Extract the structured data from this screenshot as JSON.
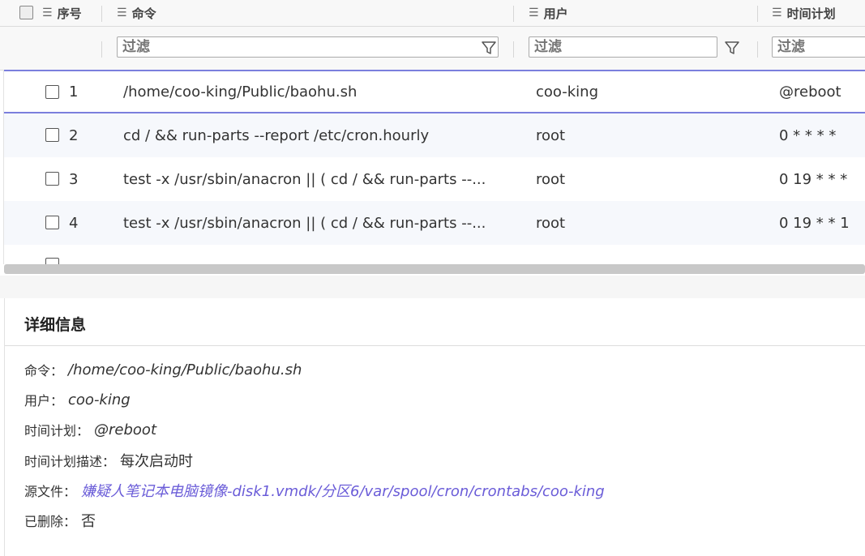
{
  "table": {
    "headers": {
      "index": "序号",
      "command": "命令",
      "user": "用户",
      "schedule": "时间计划"
    },
    "filter_placeholder": "过滤",
    "rows": [
      {
        "index": "1",
        "command": "/home/coo-king/Public/baohu.sh",
        "user": "coo-king",
        "schedule": "@reboot"
      },
      {
        "index": "2",
        "command": "cd / && run-parts --report /etc/cron.hourly",
        "user": "root",
        "schedule": "0 * * * *"
      },
      {
        "index": "3",
        "command": "test -x /usr/sbin/anacron || ( cd / && run-parts --...",
        "user": "root",
        "schedule": "0 19 * * *"
      },
      {
        "index": "4",
        "command": "test -x /usr/sbin/anacron || ( cd / && run-parts --...",
        "user": "root",
        "schedule": "0 19 * * 1"
      }
    ]
  },
  "details": {
    "title": "详细信息",
    "command_label": "命令：",
    "command_value": "/home/coo-king/Public/baohu.sh",
    "user_label": "用户：",
    "user_value": "coo-king",
    "schedule_label": "时间计划：",
    "schedule_value": "@reboot",
    "schedule_desc_label": "时间计划描述：",
    "schedule_desc_value": "每次启动时",
    "source_label": "源文件：",
    "source_value": "嫌疑人笔记本电脑镜像-disk1.vmdk/分区6/var/spool/cron/crontabs/coo-king",
    "deleted_label": "已删除：",
    "deleted_value": "否"
  },
  "colors": {
    "selection_border": "#7b7fdd",
    "link": "#6a5cd8"
  },
  "icons": [
    "checkbox-icon",
    "menu-lines-icon",
    "filter-funnel-icon"
  ]
}
